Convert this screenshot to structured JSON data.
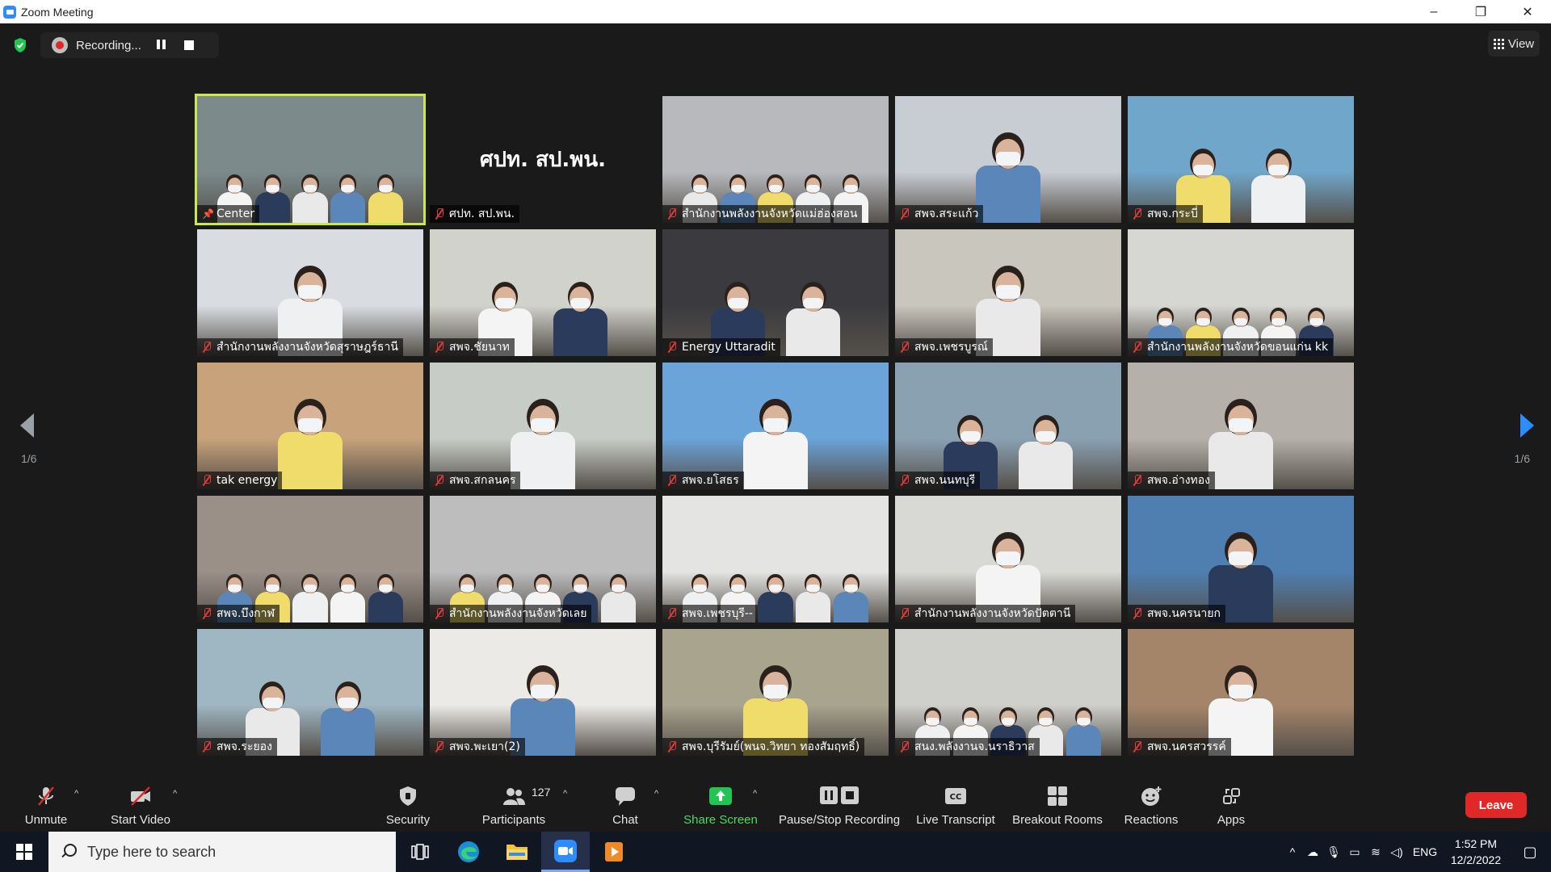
{
  "window": {
    "title": "Zoom Meeting",
    "controls": [
      "–",
      "❐",
      "✕"
    ]
  },
  "meeting": {
    "recording_label": "Recording...",
    "view_label": "View",
    "page_left": "1/6",
    "page_right": "1/6"
  },
  "tiles": [
    {
      "name": "Center",
      "pinned": true,
      "active": true,
      "scene": "group",
      "bg": "#7c8a8c"
    },
    {
      "name": "ศปท. สป.พน.",
      "blank": true,
      "blank_text": "ศปท. สป.พน."
    },
    {
      "name": "สำนักงานพลังงานจังหวัดแม่ฮ่องสอน",
      "scene": "group",
      "bg": "#b7b9bd"
    },
    {
      "name": "สพจ.สระแก้ว",
      "scene": "one",
      "bg": "#c8cdd4"
    },
    {
      "name": "สพจ.กระบี่",
      "scene": "two",
      "bg": "#6fa6c9"
    },
    {
      "name": "สำนักงานพลังงานจังหวัดสุราษฎร์ธานี",
      "scene": "one",
      "bg": "#d9dde2"
    },
    {
      "name": "สพจ.ชัยนาท",
      "scene": "two",
      "bg": "#d2d2cc"
    },
    {
      "name": "Energy Uttaradit",
      "scene": "two",
      "bg": "#3b3b3f"
    },
    {
      "name": "สพจ.เพชรบูรณ์",
      "scene": "one",
      "bg": "#c9c6bd"
    },
    {
      "name": "สำนักงานพลังงานจังหวัดขอนแก่น kk",
      "scene": "group",
      "bg": "#d6d6d2"
    },
    {
      "name": "tak energy",
      "scene": "one",
      "bg": "#c7a27a"
    },
    {
      "name": "สพจ.สกลนคร",
      "scene": "one",
      "bg": "#c8ccc7"
    },
    {
      "name": "สพจ.ยโสธร",
      "scene": "one",
      "bg": "#6aa4d8"
    },
    {
      "name": "สพจ.นนทบุรี",
      "scene": "two",
      "bg": "#8aa1b2"
    },
    {
      "name": "สพจ.อ่างทอง",
      "scene": "one",
      "bg": "#b5b0aa"
    },
    {
      "name": "สพจ.บึงกาฬ",
      "scene": "group",
      "bg": "#9a9088"
    },
    {
      "name": "สำนักงานพลังงานจังหวัดเลย",
      "scene": "group",
      "bg": "#bdbdbd"
    },
    {
      "name": "สพจ.เพชรบุรี--",
      "scene": "group",
      "bg": "#e4e4e2"
    },
    {
      "name": "สำนักงานพลังงานจังหวัดปัตตานี",
      "scene": "one",
      "bg": "#d8d8d4"
    },
    {
      "name": "สพจ.นครนายก",
      "scene": "one",
      "bg": "#4f7fb0"
    },
    {
      "name": "สพจ.ระยอง",
      "scene": "two",
      "bg": "#9fb7c2"
    },
    {
      "name": "สพจ.พะเยา(2)",
      "scene": "one",
      "bg": "#eceae6"
    },
    {
      "name": "สพจ.บุรีรัมย์(พนจ.วิทยา ทองสัมฤทธิ์)",
      "scene": "one",
      "bg": "#a8a48e"
    },
    {
      "name": "สนง.พลังงานจ.นราธิวาส",
      "scene": "group",
      "bg": "#cfcfcb"
    },
    {
      "name": "สพจ.นครสวรรค์",
      "scene": "one",
      "bg": "#a5856a"
    }
  ],
  "toolbar": {
    "unmute": "Unmute",
    "start_video": "Start Video",
    "security": "Security",
    "participants": "Participants",
    "participants_count": "127",
    "chat": "Chat",
    "share_screen": "Share Screen",
    "pause_stop": "Pause/Stop Recording",
    "live_transcript": "Live Transcript",
    "breakout": "Breakout Rooms",
    "reactions": "Reactions",
    "apps": "Apps",
    "leave": "Leave",
    "share_color": "#4cd964",
    "leave_color": "#e02828"
  },
  "taskbar": {
    "search_placeholder": "Type here to search",
    "lang": "ENG",
    "time": "1:52 PM",
    "date": "12/2/2022"
  }
}
